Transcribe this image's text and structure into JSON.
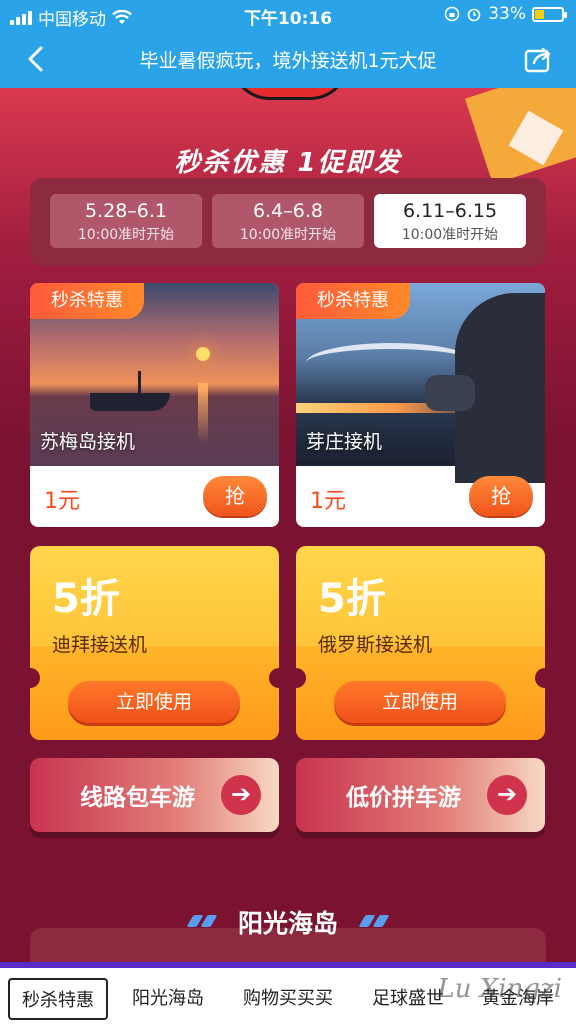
{
  "status_bar": {
    "carrier": "中国移动",
    "time": "下午10:16",
    "battery": "33%",
    "icons": [
      "signal-icon",
      "wifi-icon",
      "lock-rotation-icon",
      "alarm-icon",
      "battery-icon"
    ]
  },
  "nav": {
    "title": "毕业暑假疯玩，境外接送机1元大促",
    "back_icon": "chevron-left-icon",
    "share_icon": "share-icon"
  },
  "flash_sale": {
    "title": "秒杀优惠 1促即发",
    "dates": [
      {
        "date": "5.28–6.1",
        "time": "10:00准时开始",
        "active": false
      },
      {
        "date": "6.4–6.8",
        "time": "10:00准时开始",
        "active": false
      },
      {
        "date": "6.11–6.15",
        "time": "10:00准时开始",
        "active": true
      }
    ]
  },
  "deals": [
    {
      "tag": "秒杀特惠",
      "name": "苏梅岛接机",
      "price": "1元",
      "button": "抢"
    },
    {
      "tag": "秒杀特惠",
      "name": "芽庄接机",
      "price": "1元",
      "button": "抢"
    }
  ],
  "coupons": [
    {
      "discount": "5折",
      "name": "迪拜接送机",
      "button": "立即使用"
    },
    {
      "discount": "5折",
      "name": "俄罗斯接送机",
      "button": "立即使用"
    }
  ],
  "tours": [
    {
      "label": "线路包车游",
      "icon": "arrow-right-icon"
    },
    {
      "label": "低价拼车游",
      "icon": "arrow-right-icon"
    }
  ],
  "section2": {
    "title": "阳光海岛"
  },
  "tabs": [
    "秒杀特惠",
    "阳光海岛",
    "购物买买买",
    "足球盛世",
    "黄金海岸"
  ],
  "active_tab": 0,
  "watermark": "Lu Xingzi",
  "colors": {
    "nav_blue": "#2aa3e8",
    "page_bg": "#7a1230",
    "accent_orange": "#ff5a2a",
    "coupon_yellow": "#ffc53a"
  }
}
